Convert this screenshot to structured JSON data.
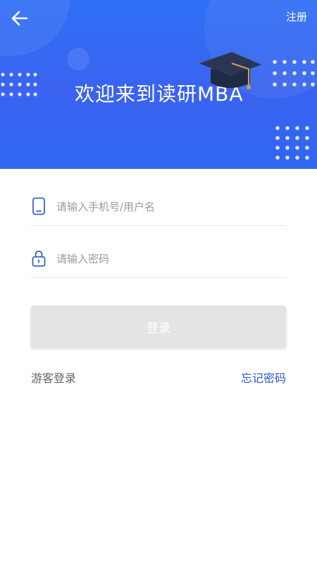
{
  "header": {
    "welcome_text": "欢迎来到读研MBA",
    "register_label": "注册",
    "back_icon": "arrow-left-icon",
    "decoration_icon": "graduation-cap-icon"
  },
  "form": {
    "username": {
      "placeholder": "请输入手机号/用户名",
      "value": "",
      "icon": "phone-icon"
    },
    "password": {
      "placeholder": "请输入密码",
      "value": "",
      "icon": "lock-icon"
    },
    "login_label": "登录"
  },
  "links": {
    "guest_login": "游客登录",
    "forgot_password": "忘记密码"
  },
  "colors": {
    "header_blue": "#2f6ff5",
    "link_blue": "#2b57c9",
    "button_disabled": "#e4e4e4",
    "icon_blue": "#3a63c8"
  }
}
